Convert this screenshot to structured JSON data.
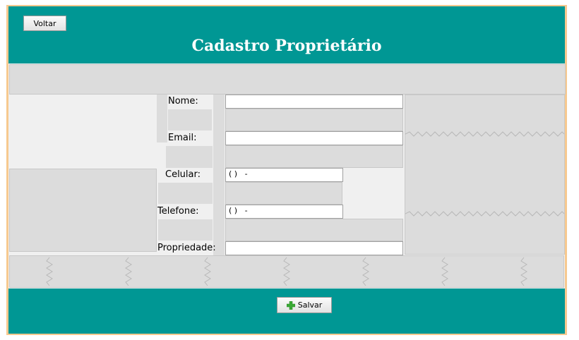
{
  "header": {
    "back_label": "Voltar",
    "title": "Cadastro Proprietário"
  },
  "form": {
    "nome": {
      "label": "Nome:",
      "value": ""
    },
    "email": {
      "label": "Email:",
      "value": ""
    },
    "celular": {
      "label": "Celular:",
      "value": "( )   -"
    },
    "telefone": {
      "label": "Telefone:",
      "value": "( )   -"
    },
    "propriedade": {
      "label": "Propriedade:",
      "value": ""
    }
  },
  "footer": {
    "save_label": "Salvar",
    "save_icon": "plus-icon"
  },
  "colors": {
    "header_bg": "#009794",
    "plus_icon": "#3aaa35"
  }
}
